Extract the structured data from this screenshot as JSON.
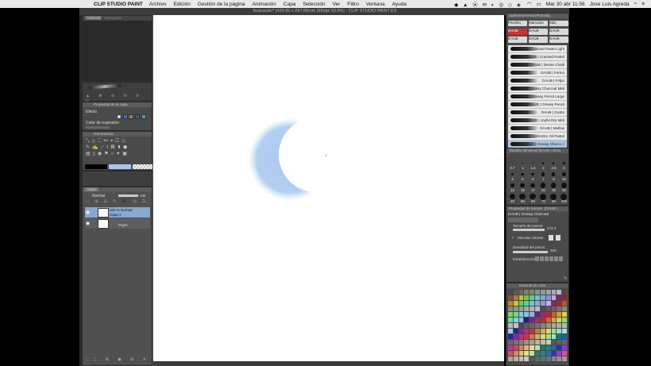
{
  "menubar": {
    "apple_glyph": "",
    "app": "CLIP STUDIO PAINT",
    "items": [
      "Archivo",
      "Edición",
      "Gestión de la página",
      "Animación",
      "Capa",
      "Selección",
      "Ver",
      "Filtro",
      "Ventana",
      "Ayuda"
    ],
    "datetime": "Mar 30 abr 11:56",
    "user": "Jose Luis Agreda"
  },
  "window": {
    "title": "ilustración* (420.00 x 297.00mm 300dpi 33.6%) - CLIP STUDIO PAINT EX"
  },
  "left": {
    "navigator_tabs": [
      "Subvista",
      "Navegador"
    ],
    "layer_property": {
      "title": "Propiedad de la capa",
      "effect_label": "Efecto",
      "expression_color_label": "Color de expresión"
    },
    "tool_title": "Herramienta",
    "layers": {
      "tabs": [
        "Capa",
        ""
      ],
      "blend_mode": "Normal",
      "opacity": "100",
      "items": [
        {
          "meta": "100 % Normal",
          "name": "Capa 1",
          "selected": true
        },
        {
          "meta": "",
          "name": "Papel",
          "selected": false
        }
      ]
    }
  },
  "right": {
    "subtool": {
      "title": "Subherramienta [Plumilla]",
      "tabs": [
        "Plumilla",
        "Marcador",
        "Más"
      ],
      "groups": [
        "DAUB",
        "DAUB",
        "DAUB",
        "DAUB",
        "DAUB",
        "DAUB"
      ],
      "brushes": [
        "DAUB | Cracked Pastel Light",
        "DAUB | Cracked Pastel",
        "DAUB | Dense Chalk",
        "DAUB | Farmo",
        "DAUB | Folpo",
        "DAUB | Greasy Charcoal Midi",
        "DAUB | Greasy Pencil Large",
        "DAUB | Greasy Pencil",
        "DAUB | Gretto",
        "DAUB | Joyful Dry Midi",
        "DAUB | Mellow",
        "DAUB | NotSoDry Oil Pastel",
        "DAUB | Greasy Charcoal"
      ],
      "selected_index": 12
    },
    "brush_size": {
      "title": "Tamaño del pincel [DAUB | Grea",
      "sizes": [
        "0.7",
        "1",
        "1.5",
        "2",
        "2.5",
        "3",
        "4",
        "5",
        "6",
        "7",
        "8",
        "10",
        "12",
        "15",
        "17",
        "20",
        "25",
        "30",
        "40",
        "50",
        "60",
        "70",
        "80",
        "100"
      ]
    },
    "tool_property": {
      "title": "Propiedad de herram. [DAUB |",
      "tool_name": "DAUB | Greasy Charcoal",
      "brush_size_label": "Tamaño del pincel",
      "brush_size_value": "472.4",
      "mix_colors_label": "Mezclar colores",
      "brush_density_label": "Densidad del pincel",
      "brush_density_value": "100",
      "stabilization_label": "Estabilización"
    },
    "color_set": {
      "title": "Historial de color"
    }
  }
}
